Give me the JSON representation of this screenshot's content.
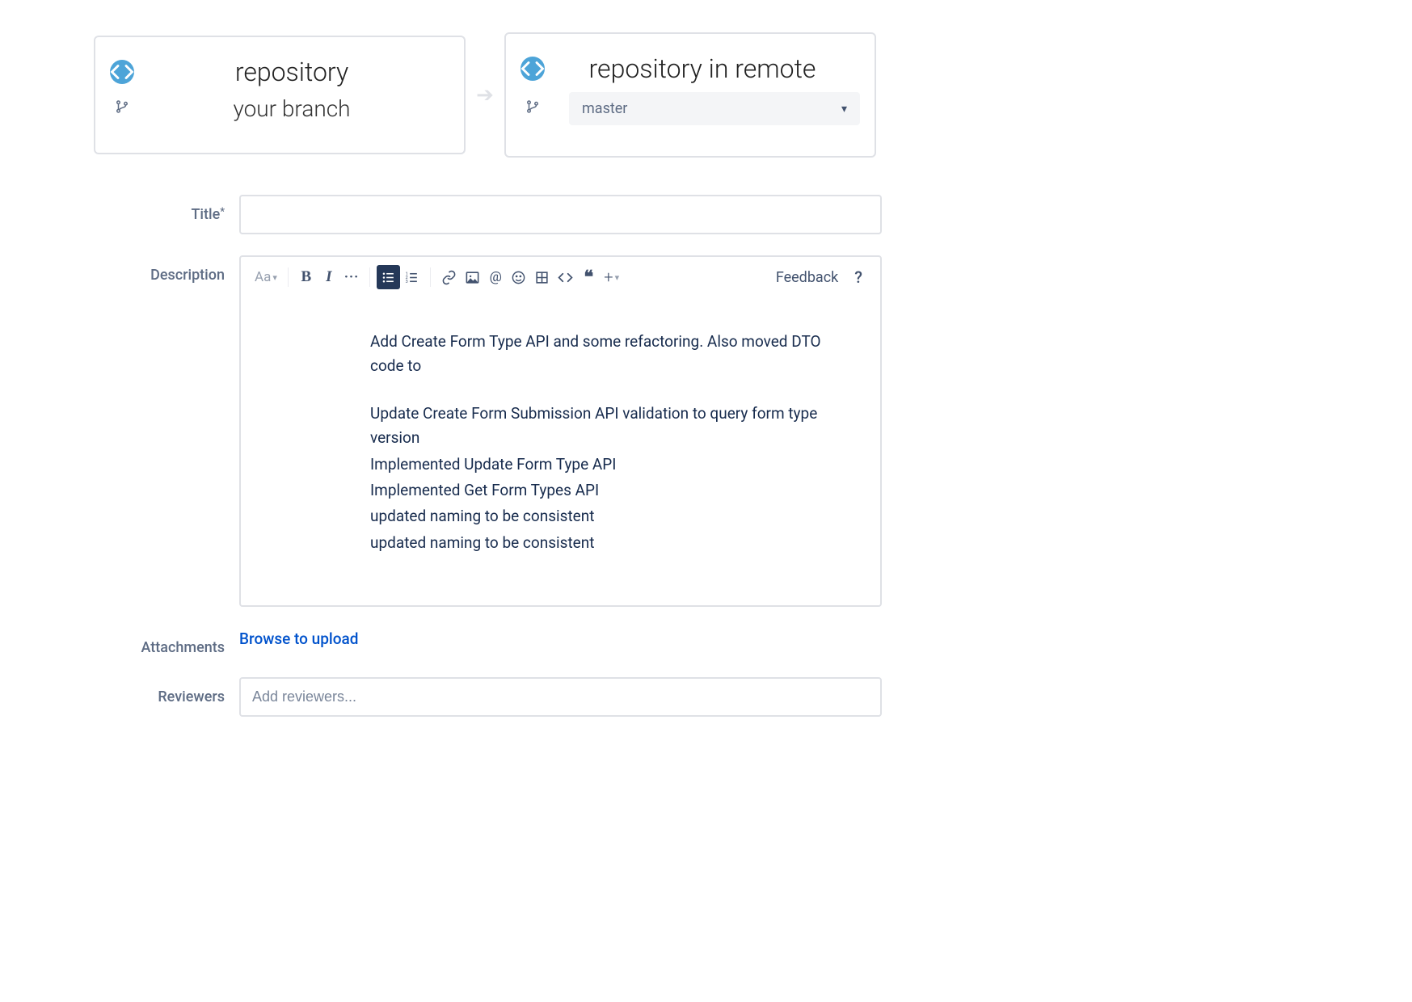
{
  "source": {
    "repo_label": "repository",
    "branch_label": "your branch"
  },
  "target": {
    "repo_label": "repository in remote",
    "branch_selected": "master"
  },
  "labels": {
    "title": "Title",
    "required_marker": "*",
    "description": "Description",
    "attachments": "Attachments",
    "browse_upload": "Browse to upload",
    "reviewers": "Reviewers",
    "reviewers_placeholder": "Add reviewers...",
    "feedback": "Feedback",
    "help_mark": "?",
    "text_styles_label": "Aa"
  },
  "title_value": "",
  "description_lines": {
    "l1": "Add Create Form Type API and some refactoring. Also moved DTO code to",
    "l2": "Update Create Form Submission API validation to query form type version",
    "l3": "Implemented Update Form Type API",
    "l4": "Implemented Get Form Types API",
    "l5": "updated naming to be consistent",
    "l6": "updated naming to be consistent"
  }
}
